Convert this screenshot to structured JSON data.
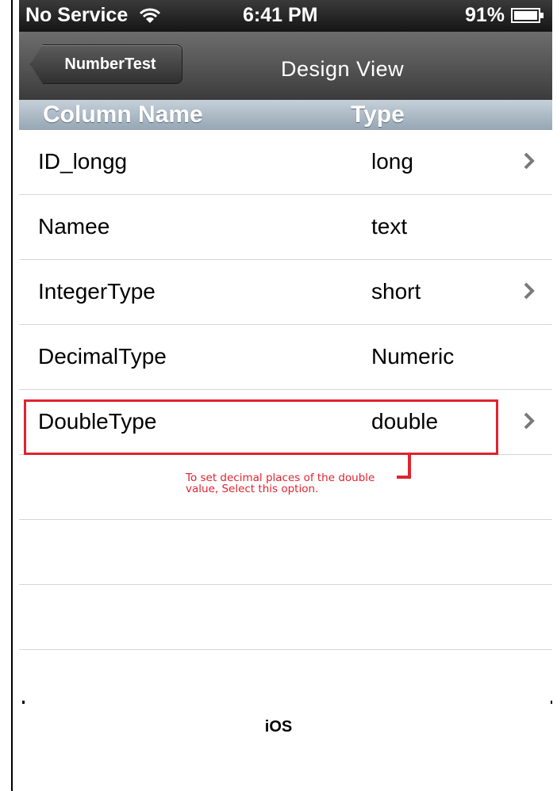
{
  "statusbar": {
    "carrier": "No Service",
    "time": "6:41 PM",
    "battery": "91%"
  },
  "navbar": {
    "back_label": "NumberTest",
    "title": "Design View"
  },
  "table_header": {
    "name": "Column Name",
    "type": "Type"
  },
  "rows": [
    {
      "name": "ID_longg",
      "type": "long",
      "chevron": true
    },
    {
      "name": "Namee",
      "type": "text",
      "chevron": false
    },
    {
      "name": "IntegerType",
      "type": "short",
      "chevron": true
    },
    {
      "name": "DecimalType",
      "type": "Numeric",
      "chevron": false
    },
    {
      "name": "DoubleType",
      "type": "double",
      "chevron": true
    }
  ],
  "annotation": {
    "text": "To set decimal places of the double value, Select this option.",
    "color": "#e0232f"
  },
  "caption": "iOS"
}
